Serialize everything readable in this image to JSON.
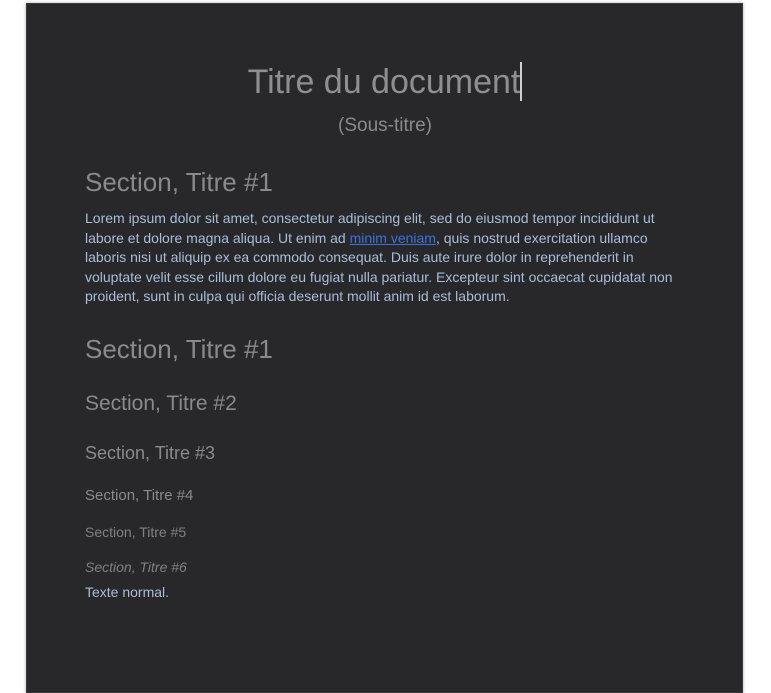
{
  "document": {
    "title": "Titre du document",
    "subtitle": "(Sous-titre)",
    "section1_heading": "Section, Titre #1",
    "paragraph": {
      "before_link": "Lorem ipsum dolor sit amet, consectetur adipiscing elit, sed do eiusmod tempor incididunt ut labore et dolore magna aliqua. Ut enim ad ",
      "link_text": "minim veniam",
      "after_link": ", quis nostrud exercitation ullamco laboris nisi ut aliquip ex ea commodo consequat. Duis aute irure dolor in reprehenderit in voluptate velit esse cillum dolore eu fugiat nulla pariatur. Excepteur sint occaecat cupidatat non proident, sunt in culpa qui officia deserunt mollit anim id est laborum."
    },
    "headings": {
      "h1": "Section, Titre #1",
      "h2": "Section, Titre #2",
      "h3": "Section, Titre #3",
      "h4": "Section, Titre #4",
      "h5": "Section, Titre #5",
      "h6": "Section, Titre #6"
    },
    "normal_text": "Texte normal."
  },
  "colors": {
    "page_background": "#28282b",
    "heading_text": "#8a8a8a",
    "body_text": "#a9bdd9",
    "link": "#3f6fd8",
    "caret": "#cfcfcf"
  }
}
